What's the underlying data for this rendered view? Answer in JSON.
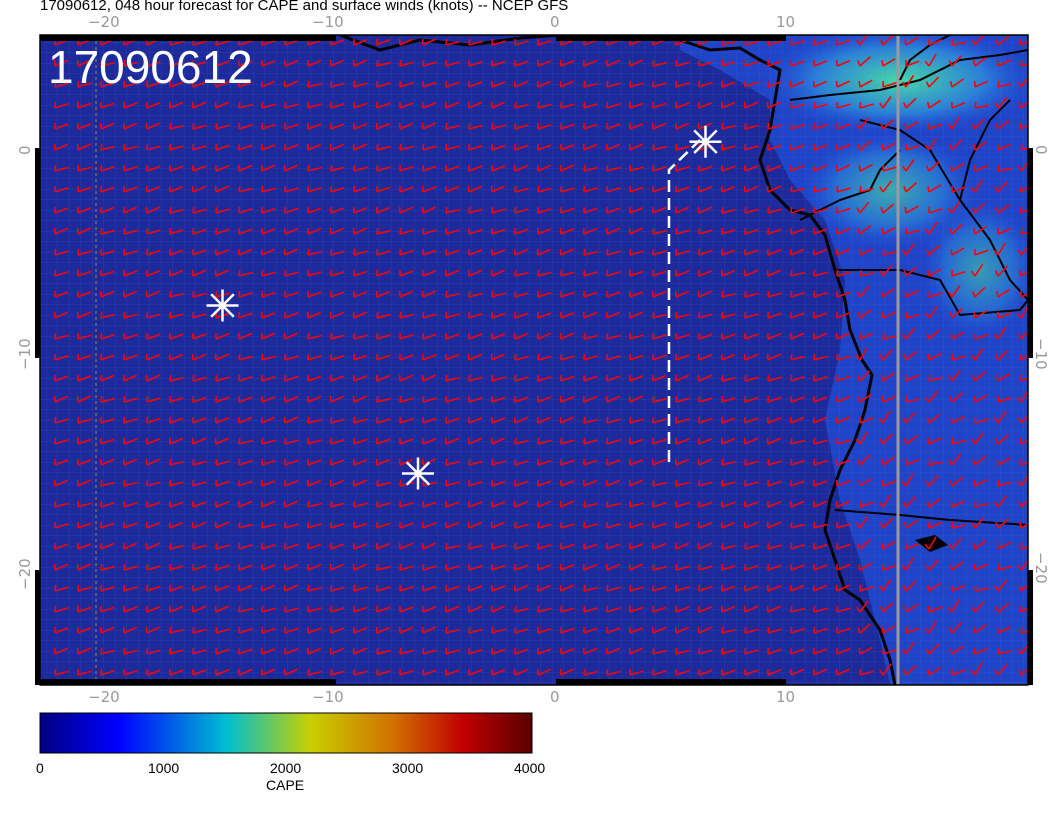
{
  "title": "17090612, 048 hour forecast for CAPE and surface winds (knots) -- NCEP GFS",
  "stamp": "17090612",
  "axes": {
    "top_ticks": [
      "−20",
      "−10",
      "0",
      "10"
    ],
    "bottom_ticks": [
      "−20",
      "−10",
      "0",
      "10"
    ],
    "left_ticks": [
      "0",
      "−10",
      "−20"
    ],
    "right_ticks": [
      "0",
      "−10",
      "−20"
    ]
  },
  "colorbar": {
    "label": "CAPE",
    "ticks": [
      "0",
      "1000",
      "2000",
      "3000",
      "4000"
    ],
    "colors": [
      "#00007f",
      "#0000ff",
      "#00bfd0",
      "#c8d000",
      "#d07000",
      "#c00000",
      "#5a0000"
    ]
  },
  "colors": {
    "ocean": "#1c2a9c",
    "land_low": "#1f4ed8",
    "land_high": "#35c9b8",
    "wind": "#ff0000",
    "coast": "#000000",
    "track": "#ffffff"
  },
  "markers": [
    {
      "name": "star-west",
      "lon": -14.5,
      "lat": -7.5
    },
    {
      "name": "star-south",
      "lon": -6,
      "lat": -15.5
    },
    {
      "name": "star-north",
      "lon": 6.5,
      "lat": 0.3
    }
  ]
}
